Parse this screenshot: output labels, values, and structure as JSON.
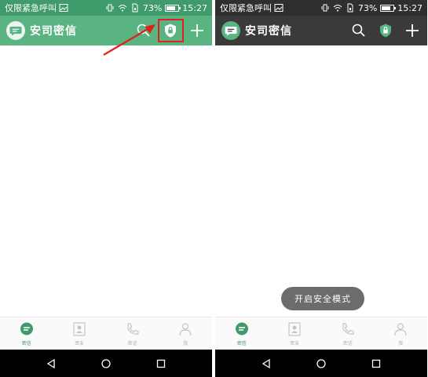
{
  "screens": [
    {
      "status": {
        "carrier": "仅限紧急呼叫",
        "battery": "73%",
        "battery_level": 0.73,
        "time": "15:27"
      },
      "header": {
        "title": "安司密信"
      },
      "tabs": [
        {
          "label": "密信",
          "icon": "chat-icon"
        },
        {
          "label": "密友",
          "icon": "contacts-icon"
        },
        {
          "label": "密话",
          "icon": "phone-icon"
        },
        {
          "label": "我",
          "icon": "person-icon"
        }
      ]
    },
    {
      "status": {
        "carrier": "仅限紧急呼叫",
        "battery": "73%",
        "battery_level": 0.73,
        "time": "15:27"
      },
      "header": {
        "title": "安司密信"
      },
      "toast": "开启安全模式",
      "tabs": [
        {
          "label": "密信",
          "icon": "chat-icon"
        },
        {
          "label": "密友",
          "icon": "contacts-icon"
        },
        {
          "label": "密话",
          "icon": "phone-icon"
        },
        {
          "label": "我",
          "icon": "person-icon"
        }
      ]
    }
  ],
  "colors": {
    "header_normal": "#5ab482",
    "header_secure": "#3a3a3a",
    "accent": "#3f9a6c",
    "highlight": "#e0201f"
  }
}
